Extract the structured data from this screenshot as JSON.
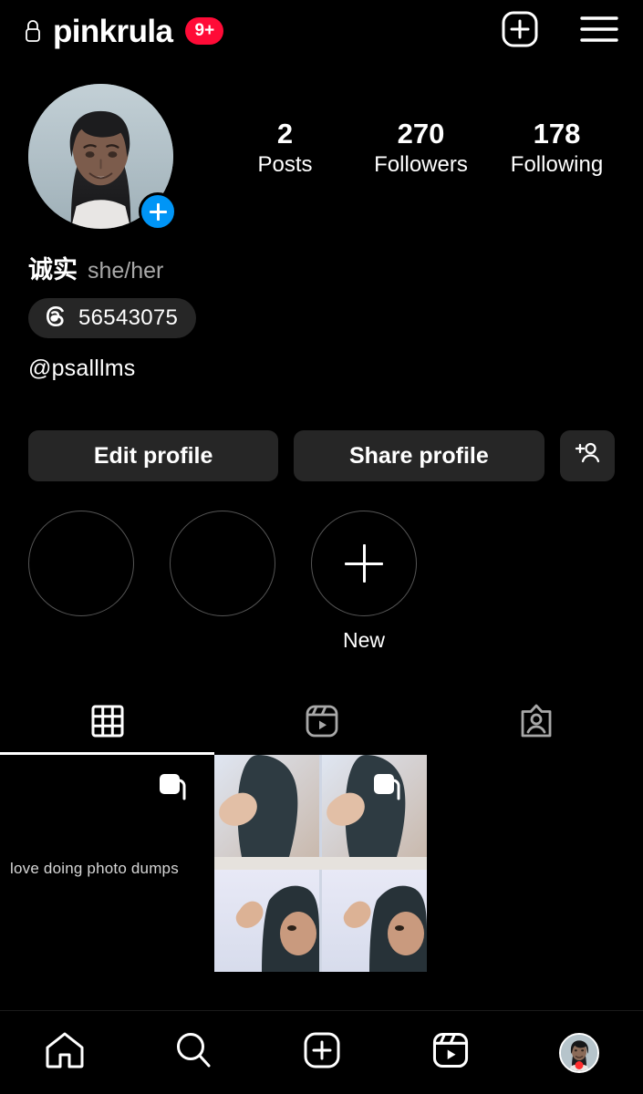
{
  "header": {
    "lock_icon": "lock-icon",
    "username": "pinkrula",
    "notification_badge": "9+",
    "badge_color": "#ff0b37",
    "create_icon": "plus-square-icon",
    "menu_icon": "hamburger-menu-icon"
  },
  "profile": {
    "avatar_name": "profile-avatar",
    "add_story_icon": "plus-icon",
    "stats": [
      {
        "value": "2",
        "label": "Posts"
      },
      {
        "value": "270",
        "label": "Followers"
      },
      {
        "value": "178",
        "label": "Following"
      }
    ],
    "display_name": "诚实",
    "pronouns": "she/her",
    "threads_icon": "threads-icon",
    "threads_count": "56543075",
    "bio": "@psalllms"
  },
  "actions": {
    "edit_label": "Edit profile",
    "share_label": "Share profile",
    "add_user_icon": "add-person-icon"
  },
  "highlights": [
    {
      "label": "",
      "icon": ""
    },
    {
      "label": "",
      "icon": ""
    },
    {
      "label": "New",
      "icon": "plus-icon"
    }
  ],
  "tabs": [
    {
      "name": "grid",
      "icon": "grid-icon",
      "active": true
    },
    {
      "name": "reels",
      "icon": "reels-icon",
      "active": false
    },
    {
      "name": "tagged",
      "icon": "tagged-person-icon",
      "active": false
    }
  ],
  "posts": [
    {
      "caption": "love doing photo dumps",
      "type": "carousel",
      "icon": "carousel-icon"
    },
    {
      "caption": "",
      "type": "carousel",
      "icon": "carousel-icon"
    }
  ],
  "bottom_nav": [
    {
      "name": "home",
      "icon": "home-icon"
    },
    {
      "name": "search",
      "icon": "search-icon"
    },
    {
      "name": "create",
      "icon": "plus-square-icon"
    },
    {
      "name": "reels",
      "icon": "reels-icon"
    },
    {
      "name": "profile",
      "icon": "profile-avatar-icon",
      "has_dot": true
    }
  ],
  "colors": {
    "background": "#000000",
    "surface": "#262626",
    "accent_blue": "#0095f6",
    "notification_red": "#ff0b37",
    "muted_text": "#a8a8a8"
  }
}
